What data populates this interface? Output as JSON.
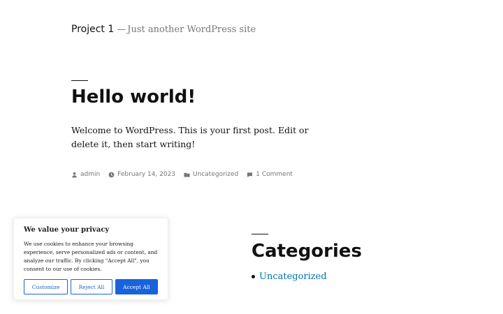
{
  "site": {
    "title": "Project 1",
    "separator": "—",
    "description": "Just another WordPress site"
  },
  "post": {
    "title": "Hello world!",
    "content": "Welcome to WordPress. This is your first post. Edit or delete it, then start writing!",
    "meta": {
      "author": "admin",
      "date": "February 14, 2023",
      "category": "Uncategorized",
      "comments": "1 Comment"
    }
  },
  "widget": {
    "title": "Categories",
    "items": [
      "Uncategorized"
    ]
  },
  "cookie": {
    "title": "We value your privacy",
    "text": "We use cookies to enhance your browsing experience, serve personalized ads or content, and analyze our traffic. By clicking \"Accept All\", you consent to our use of cookies.",
    "customize_label": "Customize",
    "reject_label": "Reject All",
    "accept_label": "Accept All"
  },
  "colors": {
    "link": "#0073aa",
    "accent": "#1863dc",
    "meta": "#767676"
  }
}
